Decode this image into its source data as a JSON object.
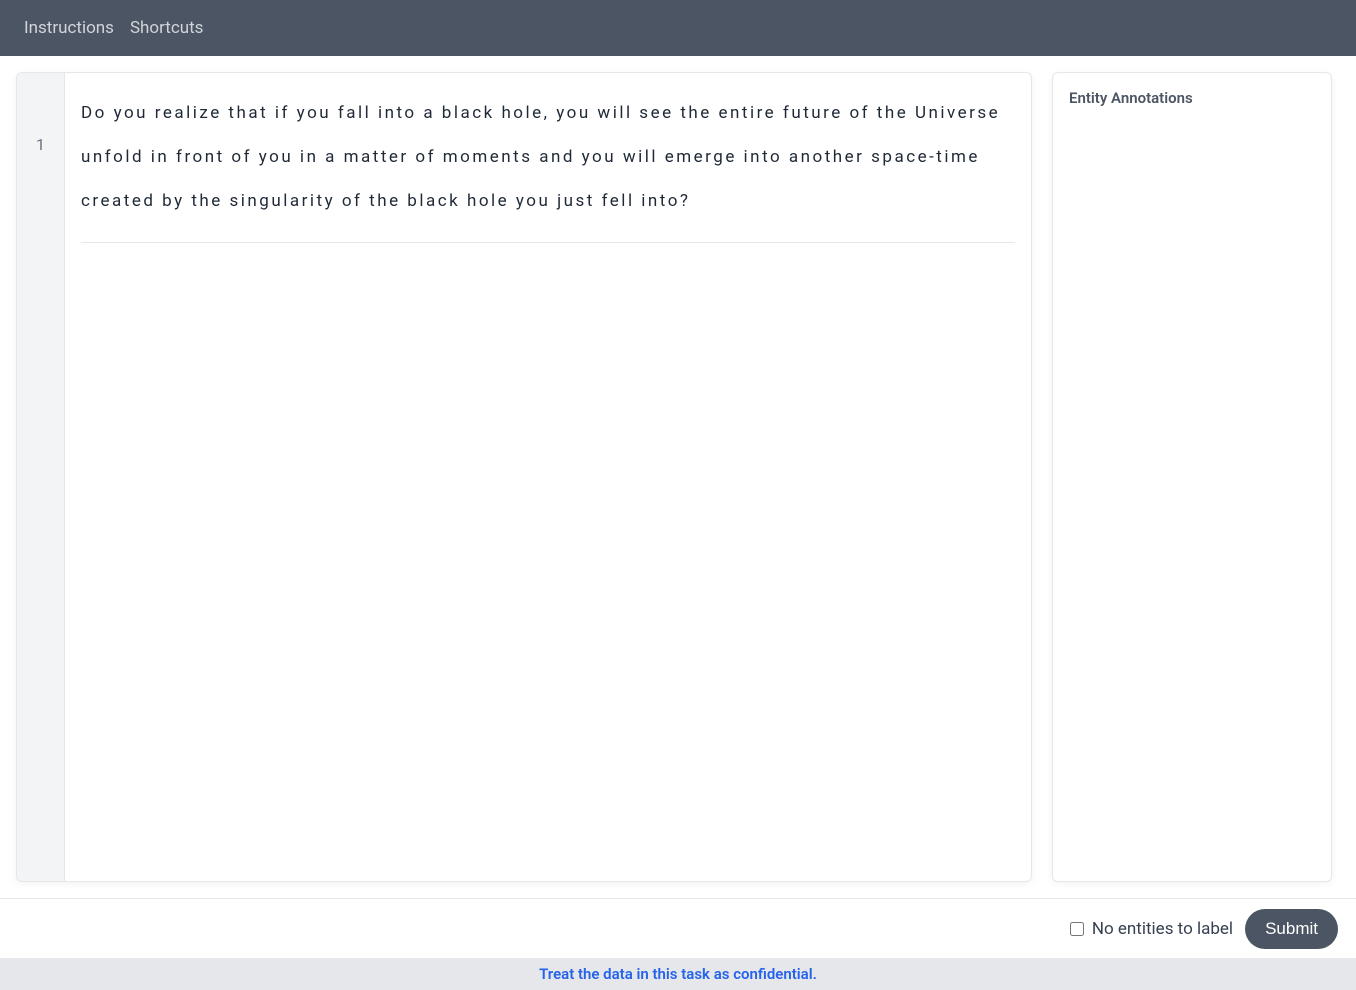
{
  "topbar": {
    "instructions": "Instructions",
    "shortcuts": "Shortcuts"
  },
  "text_panel": {
    "line_number": "1",
    "content": "Do you realize that if you fall into a black hole, you will see the entire future of the Universe unfold in front of you in a matter of moments and you will emerge into another space-time created by the singularity of the black hole you just fell into?"
  },
  "side_panel": {
    "title": "Entity Annotations"
  },
  "bottom_bar": {
    "checkbox_label": "No entities to label",
    "submit_label": "Submit"
  },
  "footer": {
    "message": "Treat the data in this task as confidential."
  }
}
